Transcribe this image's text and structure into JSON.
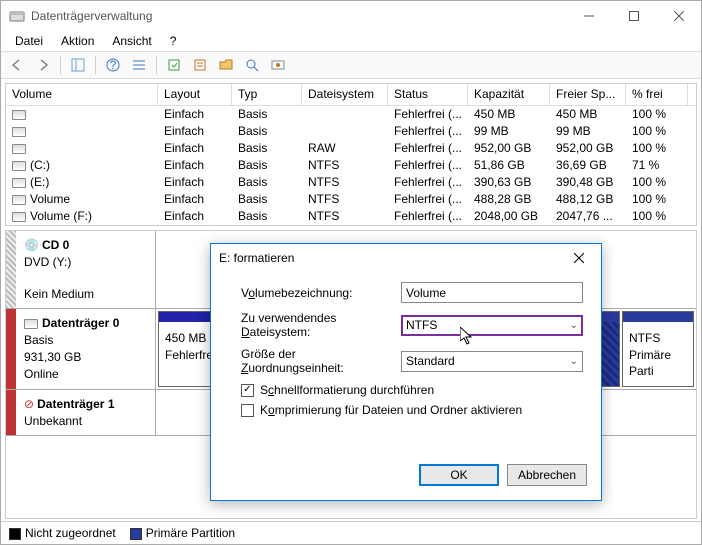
{
  "window": {
    "title": "Datenträgerverwaltung"
  },
  "menu": {
    "file": "Datei",
    "action": "Aktion",
    "view": "Ansicht",
    "help": "?"
  },
  "columns": {
    "volume": "Volume",
    "layout": "Layout",
    "type": "Typ",
    "fs": "Dateisystem",
    "status": "Status",
    "capacity": "Kapazität",
    "free": "Freier Sp...",
    "pct": "% frei"
  },
  "volumes": [
    {
      "name": "",
      "layout": "Einfach",
      "type": "Basis",
      "fs": "",
      "status": "Fehlerfrei (...",
      "capacity": "450 MB",
      "free": "450 MB",
      "pct": "100 %"
    },
    {
      "name": "",
      "layout": "Einfach",
      "type": "Basis",
      "fs": "",
      "status": "Fehlerfrei (...",
      "capacity": "99 MB",
      "free": "99 MB",
      "pct": "100 %"
    },
    {
      "name": "",
      "layout": "Einfach",
      "type": "Basis",
      "fs": "RAW",
      "status": "Fehlerfrei (...",
      "capacity": "952,00 GB",
      "free": "952,00 GB",
      "pct": "100 %"
    },
    {
      "name": "(C:)",
      "layout": "Einfach",
      "type": "Basis",
      "fs": "NTFS",
      "status": "Fehlerfrei (...",
      "capacity": "51,86 GB",
      "free": "36,69 GB",
      "pct": "71 %"
    },
    {
      "name": "(E:)",
      "layout": "Einfach",
      "type": "Basis",
      "fs": "NTFS",
      "status": "Fehlerfrei (...",
      "capacity": "390,63 GB",
      "free": "390,48 GB",
      "pct": "100 %"
    },
    {
      "name": "Volume",
      "layout": "Einfach",
      "type": "Basis",
      "fs": "NTFS",
      "status": "Fehlerfrei (...",
      "capacity": "488,28 GB",
      "free": "488,12 GB",
      "pct": "100 %"
    },
    {
      "name": "Volume (F:)",
      "layout": "Einfach",
      "type": "Basis",
      "fs": "NTFS",
      "status": "Fehlerfrei (...",
      "capacity": "2048,00 GB",
      "free": "2047,76 ...",
      "pct": "100 %"
    }
  ],
  "disks": {
    "cd0": {
      "title": "CD 0",
      "line2": "DVD (Y:)",
      "status": "Kein Medium"
    },
    "d0": {
      "title": "Datenträger 0",
      "type": "Basis",
      "size": "931,30 GB",
      "status": "Online",
      "part1": {
        "size": "450 MB",
        "state": "Fehlerfrei"
      },
      "part2": {
        "fs": "NTFS",
        "state": "Primäre Parti"
      }
    },
    "d1": {
      "title": "Datenträger 1",
      "status": "Unbekannt"
    }
  },
  "legend": {
    "unalloc": "Nicht zugeordnet",
    "primary": "Primäre Partition"
  },
  "dialog": {
    "title": "E: formatieren",
    "label_volname_pre": "V",
    "label_volname_ul": "o",
    "label_volname_post": "lumebezeichnung:",
    "label_fs_pre": "Zu verwendendes ",
    "label_fs_ul": "D",
    "label_fs_post": "ateisystem:",
    "label_alloc_pre": "Größe der ",
    "label_alloc_ul": "Z",
    "label_alloc_post": "uordnungseinheit:",
    "volname_value": "Volume",
    "fs_value": "NTFS",
    "alloc_value": "Standard",
    "quick_label_pre": "S",
    "quick_label_ul": "c",
    "quick_label_post": "hnellformatierung durchführen",
    "quick_checked": "✓",
    "compress_label_pre": "K",
    "compress_label_ul": "o",
    "compress_label_post": "mprimierung für Dateien und Ordner aktivieren",
    "ok": "OK",
    "cancel": "Abbrechen"
  }
}
